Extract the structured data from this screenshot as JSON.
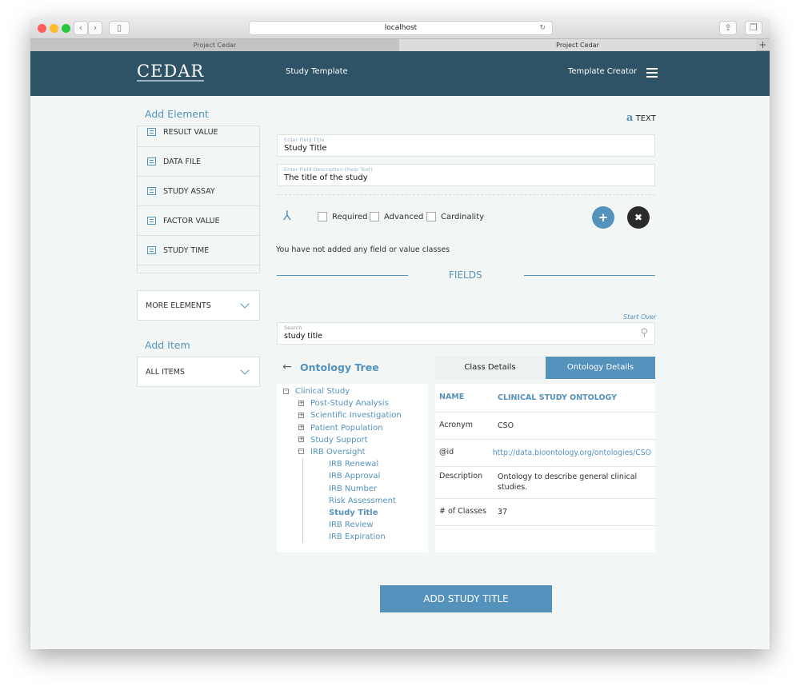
{
  "browser": {
    "url": "localhost",
    "tabs": [
      "Project Cedar",
      "Project Cedar"
    ]
  },
  "nav": {
    "logo": "CEDAR",
    "title": "Study Template",
    "right": "Template Creator"
  },
  "sidebar": {
    "add_element": "Add Element",
    "elements": [
      "RESULT VALUE",
      "DATA FILE",
      "STUDY ASSAY",
      "FACTOR VALUE",
      "STUDY TIME"
    ],
    "more_elements": "MORE ELEMENTS",
    "add_item": "Add Item",
    "all_items": "ALL ITEMS"
  },
  "field": {
    "type_icon": "a",
    "type_label": "TEXT",
    "title_placeholder": "Enter Field Title",
    "title_value": "Study Title",
    "desc_placeholder": "Enter Field Description (Help Text)",
    "desc_value": "The title of the study",
    "checkboxes": [
      "Required",
      "Advanced",
      "Cardinality"
    ],
    "no_classes": "You have not added any field or value classes"
  },
  "fields_heading": "FIELDS",
  "search": {
    "start_over": "Start Over",
    "label": "Search",
    "value": "study title"
  },
  "tree": {
    "title": "Ontology Tree",
    "root": "Clinical Study",
    "children": [
      "Post-Study Analysis",
      "Scientific Investigation",
      "Patient Population",
      "Study Support",
      "IRB Oversight"
    ],
    "leaves": [
      "IRB Renewal",
      "IRB Approval",
      "IRB Number",
      "Risk Assessment",
      "Study Title",
      "IRB Review",
      "IRB Expiration"
    ],
    "selected": "Study Title"
  },
  "details": {
    "tabs": [
      "Class Details",
      "Ontology Details"
    ],
    "active_tab": "Ontology Details",
    "name_key": "NAME",
    "name_value": "CLINICAL STUDY ONTOLOGY",
    "rows": [
      {
        "k": "Acronym",
        "v": "CSO"
      },
      {
        "k": "@id",
        "v": "http://data.bioontology.org/ontologies/CSO"
      },
      {
        "k": "Description",
        "v": "Ontology to describe general clinical studies."
      },
      {
        "k": "# of Classes",
        "v": "37"
      }
    ]
  },
  "add_button": "ADD STUDY TITLE",
  "colors": {
    "nav": "#2e5266",
    "accent": "#5592bb"
  }
}
